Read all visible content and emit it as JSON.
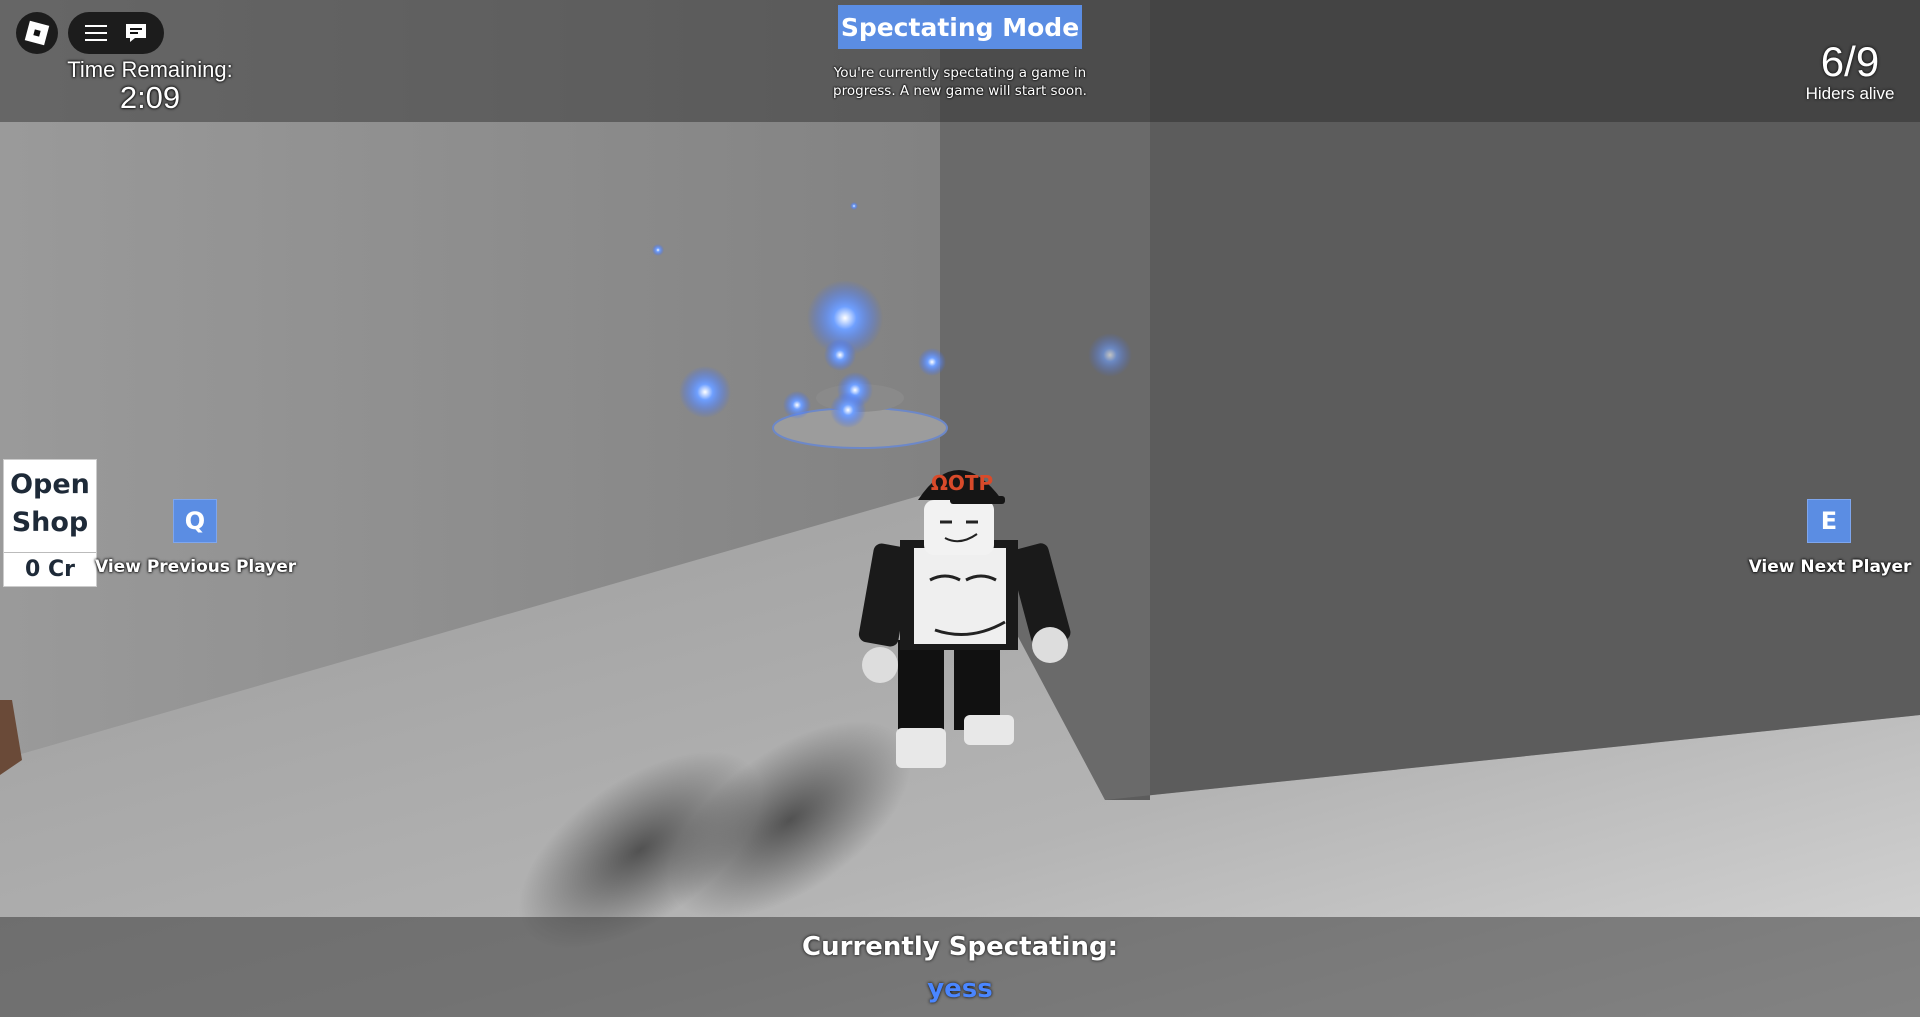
{
  "top_left": {
    "time_label": "Time Remaining:",
    "time_value": "2:09",
    "icons": [
      "roblox-logo-icon",
      "hamburger-menu-icon",
      "chat-icon"
    ]
  },
  "header": {
    "title": "Spectating Mode",
    "description": "You're currently spectating a game in progress. A new game will start soon."
  },
  "hiders": {
    "count": "6/9",
    "label": "Hiders alive"
  },
  "shop": {
    "button_label_line1": "Open",
    "button_label_line2": "Shop",
    "credits": "0 Cr"
  },
  "controls": {
    "prev_key": "Q",
    "prev_label": "View Previous Player",
    "next_key": "E",
    "next_label": "View Next Player"
  },
  "footer": {
    "spectating_label": "Currently Spectating:",
    "player_name": "yess"
  },
  "character_hat_text": "ΩOTP",
  "colors": {
    "accent_blue": "#5b8de3",
    "player_name_blue": "#4a86ff",
    "ui_dark": "#141414"
  }
}
